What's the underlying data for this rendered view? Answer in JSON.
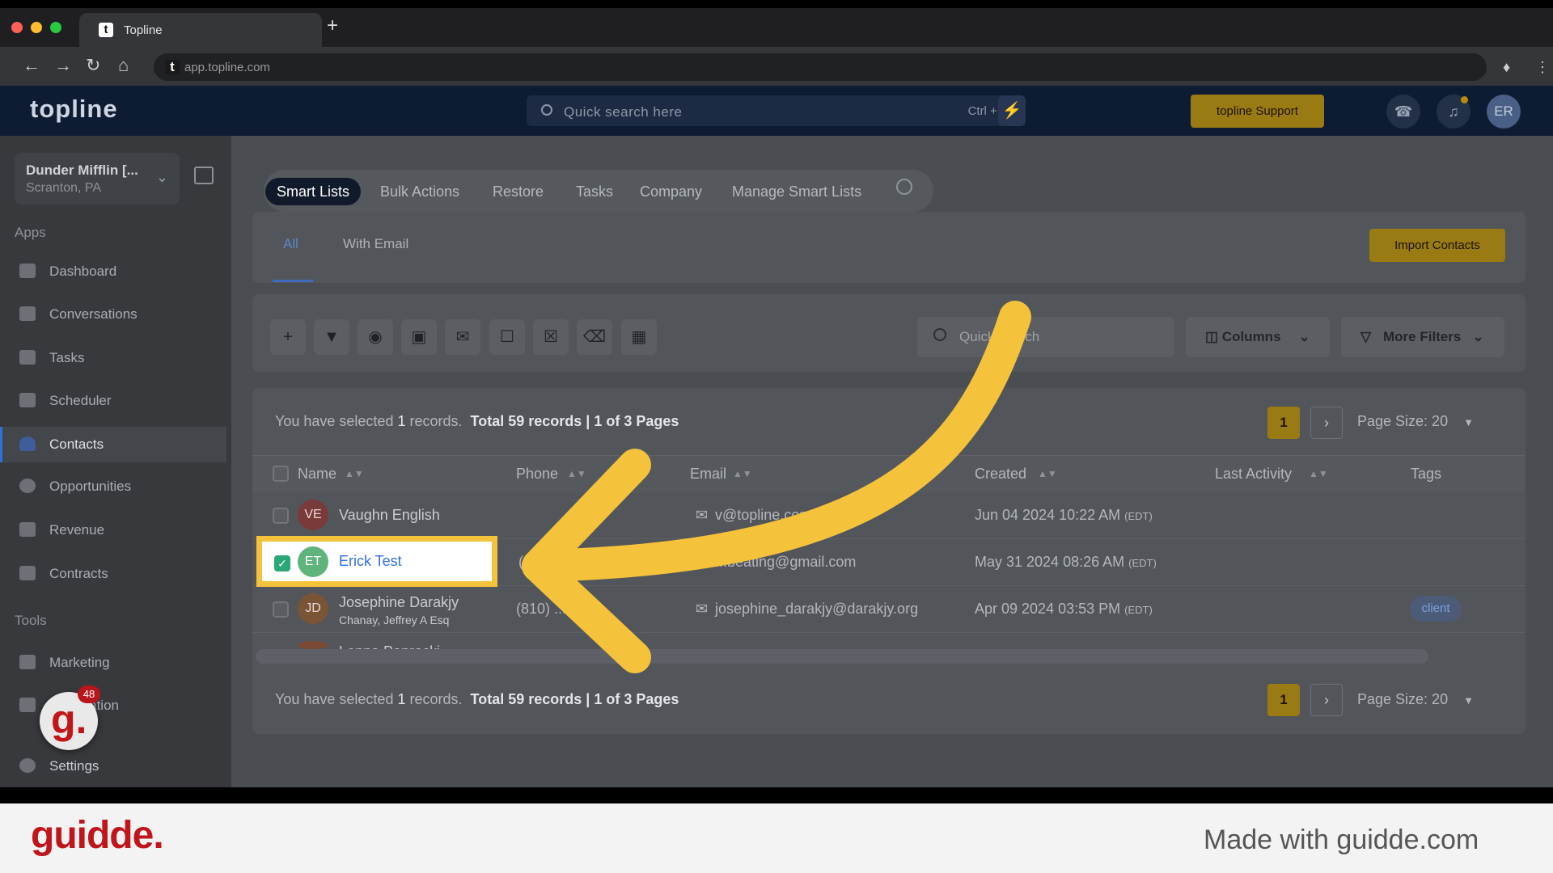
{
  "browser": {
    "tab_title": "Topline",
    "new_tab": "+",
    "url": "app.topline.com"
  },
  "header": {
    "logo": "topline",
    "search_placeholder": "Quick search here",
    "search_shortcut": "Ctrl + K",
    "support_label": "topline Support",
    "avatar_initials": "ER"
  },
  "sidebar": {
    "account_name": "Dunder Mifflin [...",
    "account_location": "Scranton, PA",
    "apps_heading": "Apps",
    "apps": [
      {
        "label": "Dashboard",
        "icon": "dashboard-icon"
      },
      {
        "label": "Conversations",
        "icon": "chat-icon"
      },
      {
        "label": "Tasks",
        "icon": "tasks-icon"
      },
      {
        "label": "Scheduler",
        "icon": "calendar-icon"
      },
      {
        "label": "Contacts",
        "icon": "user-icon"
      },
      {
        "label": "Opportunities",
        "icon": "target-icon"
      },
      {
        "label": "Revenue",
        "icon": "card-icon"
      },
      {
        "label": "Contracts",
        "icon": "document-icon"
      }
    ],
    "tools_heading": "Tools",
    "tools": [
      {
        "label": "Marketing",
        "icon": "megaphone-icon"
      },
      {
        "label": "Automation",
        "icon": "gears-icon"
      }
    ],
    "settings_label": "Settings",
    "guidde_badge_count": "48"
  },
  "top_tabs": [
    "Smart Lists",
    "Bulk Actions",
    "Restore",
    "Tasks",
    "Company",
    "Manage Smart Lists"
  ],
  "sub_tabs": [
    "All",
    "With Email"
  ],
  "import_label": "Import Contacts",
  "toolbar": {
    "search_placeholder": "Quick search",
    "columns_label": "Columns",
    "more_filters_label": "More Filters"
  },
  "selection": {
    "prefix": "You have selected",
    "count": "1",
    "suffix": "records.",
    "total": "Total 59 records",
    "pages": "1 of 3 Pages",
    "current_page": "1",
    "page_size": "Page Size: 20"
  },
  "table": {
    "columns": [
      "Name",
      "Phone",
      "Email",
      "Created",
      "Last Activity",
      "Tags"
    ],
    "rows": [
      {
        "initials": "VE",
        "name": "Vaughn English",
        "company": "",
        "phone": "",
        "email": "v@topline.com",
        "created": "Jun 04 2024 10:22 AM",
        "tz": "(EDT)",
        "tag": "",
        "checked": false,
        "avatar_color": "#7a3a3a"
      },
      {
        "initials": "ET",
        "name": "Erick Test",
        "company": "",
        "phone": "(",
        "email": "...beating@gmail.com",
        "created": "May 31 2024 08:26 AM",
        "tz": "(EDT)",
        "tag": "",
        "checked": true,
        "avatar_color": "#5fb47b"
      },
      {
        "initials": "JD",
        "name": "Josephine Darakjy",
        "company": "Chanay, Jeffrey A Esq",
        "phone": "(810) ...98",
        "email": "josephine_darakjy@darakjy.org",
        "created": "Apr 09 2024 03:53 PM",
        "tz": "(EDT)",
        "tag": "client",
        "checked": false,
        "avatar_color": "#7a5535"
      },
      {
        "initials": "LP",
        "name": "Lenna Paprocki",
        "company": "",
        "phone": "",
        "email": "",
        "created": "",
        "tz": "",
        "tag": "",
        "checked": false,
        "avatar_color": "#7a4a35"
      }
    ]
  },
  "footer": {
    "brand": "guidde.",
    "made_with": "Made with guidde.com"
  },
  "colors": {
    "accent_gold": "#f5c23b",
    "brand_red": "#c0151b",
    "link_blue": "#2f6fe0"
  }
}
